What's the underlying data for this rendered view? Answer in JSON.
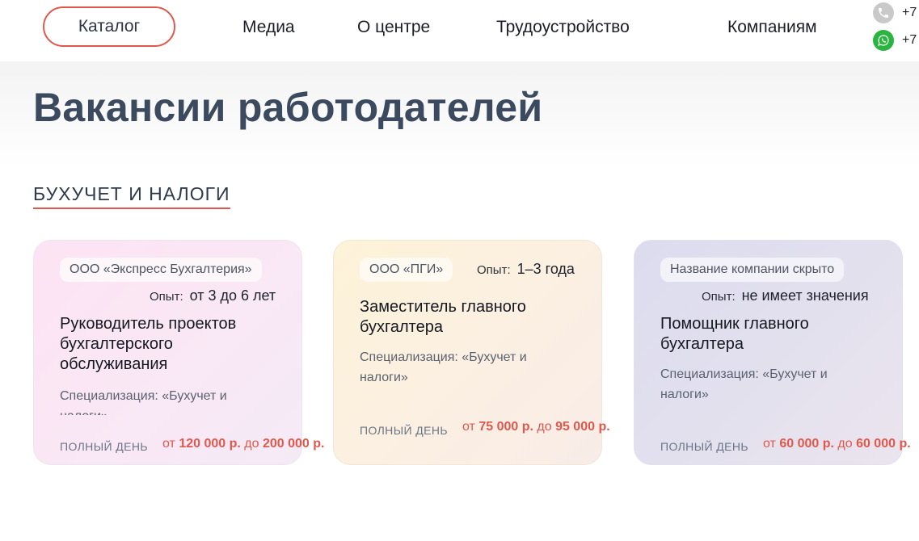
{
  "header": {
    "catalog_label": "Каталог",
    "nav": [
      "Медиа",
      "О центре",
      "Трудоустройство",
      "Компаниям"
    ],
    "phone_prefix": "+7",
    "whatsapp_prefix": "+7"
  },
  "page_title": "Вакансии работодателей",
  "section_title": "БУХУЧЕТ И НАЛОГИ",
  "colors": {
    "accent": "#e0584c",
    "title": "#3b4a5f"
  },
  "cards": [
    {
      "company": "ООО «Экспресс Бухгалтерия»",
      "exp_label": "Опыт:",
      "exp_value": "от 3 до 6 лет",
      "title": "Руководитель проектов бухгалтерского обслуживания",
      "spec": "Специализация: «Бухучет и налоги»",
      "schedule": "ПОЛНЫЙ ДЕНЬ",
      "sal_from_word": "от ",
      "sal_from": "120 000 р.",
      "sal_to_word": " до ",
      "sal_to": "200 000 р."
    },
    {
      "company": "ООО «ПГИ»",
      "exp_label": "Опыт:",
      "exp_value": "1–3 года",
      "title": "Заместитель главного бухгалтера",
      "spec": "Специализация: «Бухучет и налоги»",
      "schedule": "ПОЛНЫЙ ДЕНЬ",
      "sal_from_word": "от ",
      "sal_from": "75 000 р.",
      "sal_to_word": " до ",
      "sal_to": "95 000 р."
    },
    {
      "company": "Название компании скрыто",
      "exp_label": "Опыт:",
      "exp_value": "не имеет значения",
      "title": "Помощник главного бухгалтера",
      "spec": "Специализация: «Бухучет и налоги»",
      "schedule": "ПОЛНЫЙ ДЕНЬ",
      "sal_from_word": "от ",
      "sal_from": "60 000 р.",
      "sal_to_word": " до ",
      "sal_to": "60 000 р."
    }
  ]
}
